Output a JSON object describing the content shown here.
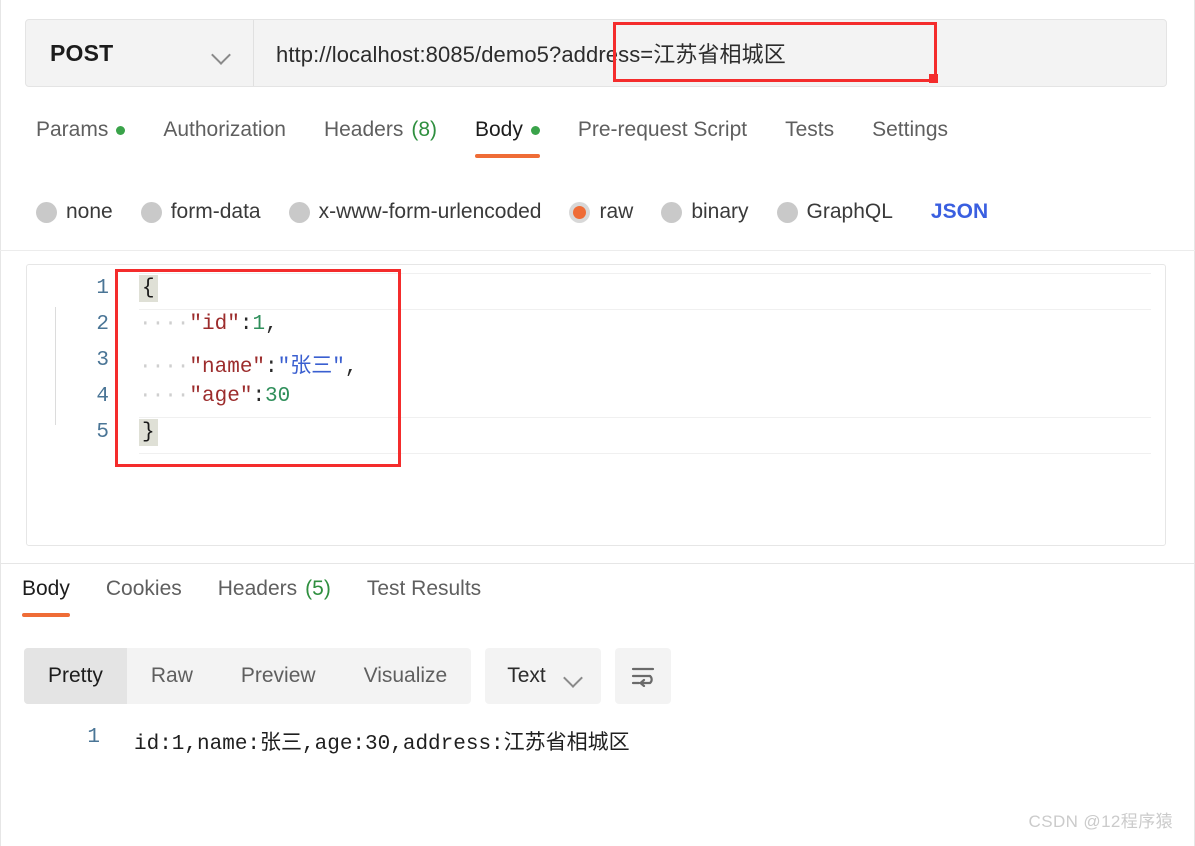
{
  "request": {
    "method": "POST",
    "method_icon": "chevron-down-icon",
    "url": "http://localhost:8085/demo5?address=江苏省相城区",
    "url_placeholder": "Enter request URL",
    "tabs": [
      {
        "label": "Params",
        "badge_dot": true,
        "active": false
      },
      {
        "label": "Authorization",
        "badge_dot": false,
        "active": false
      },
      {
        "label": "Headers",
        "count": "(8)",
        "badge_dot": false,
        "active": false
      },
      {
        "label": "Body",
        "badge_dot": true,
        "active": true
      },
      {
        "label": "Pre-request Script",
        "badge_dot": false,
        "active": false
      },
      {
        "label": "Tests",
        "badge_dot": false,
        "active": false
      },
      {
        "label": "Settings",
        "badge_dot": false,
        "active": false
      }
    ],
    "body_types": [
      {
        "label": "none",
        "selected": false
      },
      {
        "label": "form-data",
        "selected": false
      },
      {
        "label": "x-www-form-urlencoded",
        "selected": false
      },
      {
        "label": "raw",
        "selected": true
      },
      {
        "label": "binary",
        "selected": false
      },
      {
        "label": "GraphQL",
        "selected": false
      }
    ],
    "raw_format": "JSON",
    "editor": {
      "line_numbers": [
        "1",
        "2",
        "3",
        "4",
        "5"
      ],
      "lines": [
        {
          "n": "1",
          "open_brace": "{"
        },
        {
          "n": "2",
          "indent": "····",
          "key": "\"id\"",
          "colon": ":",
          "number": "1",
          "comma": ","
        },
        {
          "n": "3",
          "indent": "····",
          "key": "\"name\"",
          "colon": ":",
          "string": "\"张三\"",
          "comma": ","
        },
        {
          "n": "4",
          "indent": "····",
          "key": "\"age\"",
          "colon": ":",
          "number": "30"
        },
        {
          "n": "5",
          "close_brace": "}"
        }
      ]
    }
  },
  "response": {
    "tabs": [
      {
        "label": "Body",
        "active": true
      },
      {
        "label": "Cookies",
        "active": false
      },
      {
        "label": "Headers",
        "count": "(5)",
        "active": false
      },
      {
        "label": "Test Results",
        "active": false
      }
    ],
    "view_modes": [
      {
        "label": "Pretty",
        "active": true
      },
      {
        "label": "Raw",
        "active": false
      },
      {
        "label": "Preview",
        "active": false
      },
      {
        "label": "Visualize",
        "active": false
      }
    ],
    "format": "Text",
    "format_icon": "chevron-down-icon",
    "wrap_icon": "word-wrap-icon",
    "body": {
      "line_number": "1",
      "text": "id:1,name:张三,age:30,address:江苏省相城区"
    }
  },
  "annotations": {
    "url_box": "red-highlight-box",
    "json_box": "red-highlight-box",
    "color": "#f42c2c"
  },
  "watermark": "CSDN @12程序猿"
}
